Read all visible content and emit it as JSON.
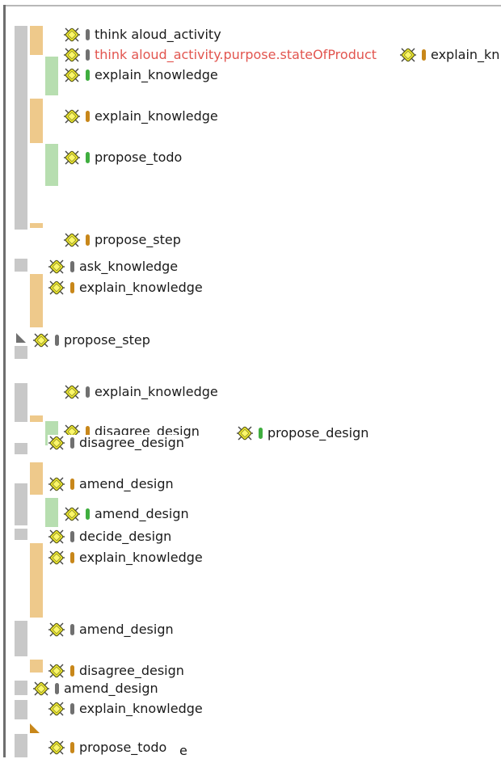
{
  "icon_name": "bug-node-icon",
  "colors": {
    "gray": "#c8c8c8",
    "orange": "#eec98b",
    "green": "#b7deb0",
    "red_label": "#e2554f"
  },
  "nodes": [
    {
      "label": "think aloud_activity"
    },
    {
      "label": "think aloud_activity.purpose.stateOfProduct"
    },
    {
      "label": "explain_kn"
    },
    {
      "label": "explain_knowledge"
    },
    {
      "label": "explain_knowledge"
    },
    {
      "label": "propose_todo"
    },
    {
      "label": "propose_step"
    },
    {
      "label": "ask_knowledge"
    },
    {
      "label": "explain_knowledge"
    },
    {
      "label": "propose_step"
    },
    {
      "label": "explain_knowledge"
    },
    {
      "label": "disagree_design"
    },
    {
      "label": "propose_design"
    },
    {
      "label": "disagree_design"
    },
    {
      "label": "amend_design"
    },
    {
      "label": "amend_design"
    },
    {
      "label": "decide_design"
    },
    {
      "label": "explain_knowledge"
    },
    {
      "label": "amend_design"
    },
    {
      "label": "disagree_design"
    },
    {
      "label": "amend_design"
    },
    {
      "label": "explain_knowledge"
    },
    {
      "label": "propose_todo"
    }
  ],
  "stray_text": "e"
}
